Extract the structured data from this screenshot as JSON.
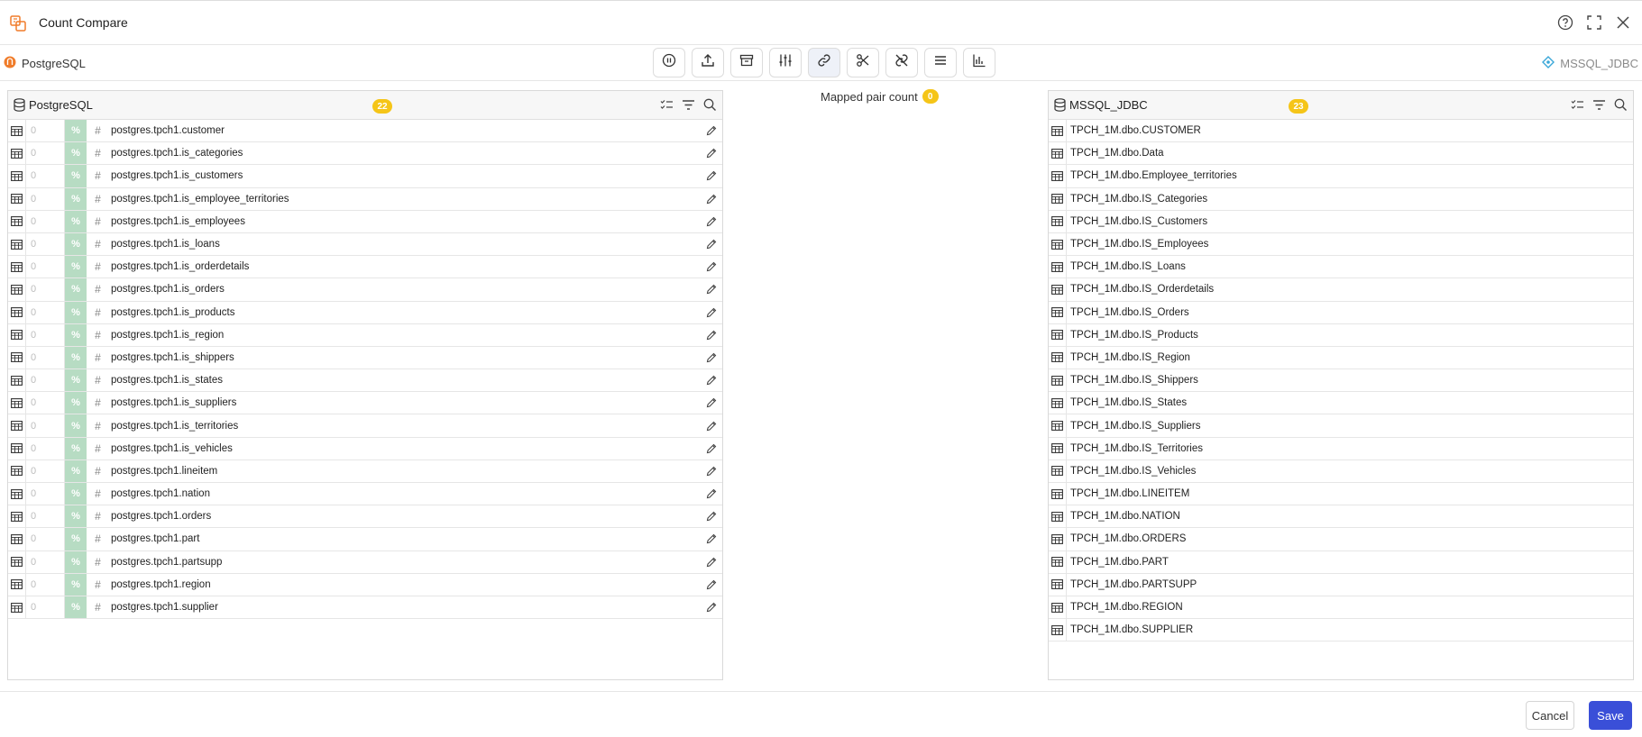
{
  "window": {
    "title": "Count Compare"
  },
  "source": {
    "label": "PostgreSQL"
  },
  "target": {
    "label": "MSSQL_JDBC"
  },
  "mapped": {
    "label": "Mapped pair count",
    "count": "0"
  },
  "left_panel": {
    "title": "PostgreSQL",
    "count": "22",
    "rows": [
      {
        "count": "0",
        "pct": "%",
        "hash": "#",
        "name": "postgres.tpch1.customer"
      },
      {
        "count": "0",
        "pct": "%",
        "hash": "#",
        "name": "postgres.tpch1.is_categories"
      },
      {
        "count": "0",
        "pct": "%",
        "hash": "#",
        "name": "postgres.tpch1.is_customers"
      },
      {
        "count": "0",
        "pct": "%",
        "hash": "#",
        "name": "postgres.tpch1.is_employee_territories"
      },
      {
        "count": "0",
        "pct": "%",
        "hash": "#",
        "name": "postgres.tpch1.is_employees"
      },
      {
        "count": "0",
        "pct": "%",
        "hash": "#",
        "name": "postgres.tpch1.is_loans"
      },
      {
        "count": "0",
        "pct": "%",
        "hash": "#",
        "name": "postgres.tpch1.is_orderdetails"
      },
      {
        "count": "0",
        "pct": "%",
        "hash": "#",
        "name": "postgres.tpch1.is_orders"
      },
      {
        "count": "0",
        "pct": "%",
        "hash": "#",
        "name": "postgres.tpch1.is_products"
      },
      {
        "count": "0",
        "pct": "%",
        "hash": "#",
        "name": "postgres.tpch1.is_region"
      },
      {
        "count": "0",
        "pct": "%",
        "hash": "#",
        "name": "postgres.tpch1.is_shippers"
      },
      {
        "count": "0",
        "pct": "%",
        "hash": "#",
        "name": "postgres.tpch1.is_states"
      },
      {
        "count": "0",
        "pct": "%",
        "hash": "#",
        "name": "postgres.tpch1.is_suppliers"
      },
      {
        "count": "0",
        "pct": "%",
        "hash": "#",
        "name": "postgres.tpch1.is_territories"
      },
      {
        "count": "0",
        "pct": "%",
        "hash": "#",
        "name": "postgres.tpch1.is_vehicles"
      },
      {
        "count": "0",
        "pct": "%",
        "hash": "#",
        "name": "postgres.tpch1.lineitem"
      },
      {
        "count": "0",
        "pct": "%",
        "hash": "#",
        "name": "postgres.tpch1.nation"
      },
      {
        "count": "0",
        "pct": "%",
        "hash": "#",
        "name": "postgres.tpch1.orders"
      },
      {
        "count": "0",
        "pct": "%",
        "hash": "#",
        "name": "postgres.tpch1.part"
      },
      {
        "count": "0",
        "pct": "%",
        "hash": "#",
        "name": "postgres.tpch1.partsupp"
      },
      {
        "count": "0",
        "pct": "%",
        "hash": "#",
        "name": "postgres.tpch1.region"
      },
      {
        "count": "0",
        "pct": "%",
        "hash": "#",
        "name": "postgres.tpch1.supplier"
      }
    ]
  },
  "right_panel": {
    "title": "MSSQL_JDBC",
    "count": "23",
    "rows": [
      "TPCH_1M.dbo.CUSTOMER",
      "TPCH_1M.dbo.Data",
      "TPCH_1M.dbo.Employee_territories",
      "TPCH_1M.dbo.IS_Categories",
      "TPCH_1M.dbo.IS_Customers",
      "TPCH_1M.dbo.IS_Employees",
      "TPCH_1M.dbo.IS_Loans",
      "TPCH_1M.dbo.IS_Orderdetails",
      "TPCH_1M.dbo.IS_Orders",
      "TPCH_1M.dbo.IS_Products",
      "TPCH_1M.dbo.IS_Region",
      "TPCH_1M.dbo.IS_Shippers",
      "TPCH_1M.dbo.IS_States",
      "TPCH_1M.dbo.IS_Suppliers",
      "TPCH_1M.dbo.IS_Territories",
      "TPCH_1M.dbo.IS_Vehicles",
      "TPCH_1M.dbo.LINEITEM",
      "TPCH_1M.dbo.NATION",
      "TPCH_1M.dbo.ORDERS",
      "TPCH_1M.dbo.PART",
      "TPCH_1M.dbo.PARTSUPP",
      "TPCH_1M.dbo.REGION",
      "TPCH_1M.dbo.SUPPLIER"
    ]
  },
  "toolbar": {
    "icons": [
      "pause-icon",
      "upload-icon",
      "archive-icon",
      "sliders-icon",
      "link-icon",
      "scissors-icon",
      "unlink-icon",
      "menu-icon",
      "bar-chart-icon"
    ]
  },
  "footer": {
    "cancel_label": "Cancel",
    "save_label": "Save"
  },
  "colors": {
    "accent": "#3a4fd8",
    "badge": "#f5c518",
    "pct_cell": "#b7dcc3",
    "brand": "#f07c2a"
  }
}
